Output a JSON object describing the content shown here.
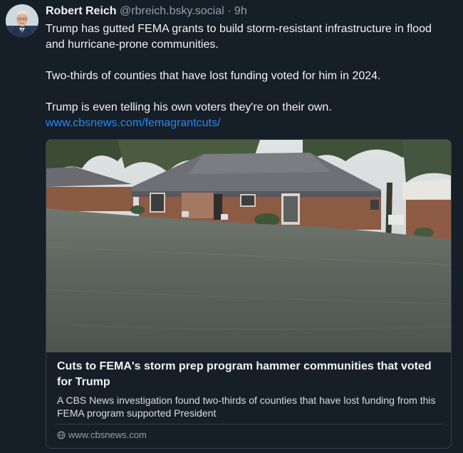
{
  "author": {
    "name": "Robert Reich",
    "handle": "@rbreich.bsky.social",
    "separator": "·",
    "time": "9h",
    "avatar_icon": "profile-photo"
  },
  "post": {
    "paragraphs": [
      "Trump has gutted FEMA grants to build storm-resistant infrastructure in flood and hurricane-prone communities.",
      "Two-thirds of counties that have lost funding voted for him in 2024.",
      "Trump is even telling his own voters they're on their own."
    ],
    "link_text": "www.cbsnews.com/femagrantcuts/"
  },
  "card": {
    "image_description_icon": "flooded-houses-photo",
    "title": "Cuts to FEMA's storm prep program hammer communities that voted for Trump",
    "description": "A CBS News investigation found two-thirds of counties that have lost funding from this FEMA program supported President",
    "domain": "www.cbsnews.com",
    "domain_icon": "globe-icon"
  },
  "colors": {
    "background": "#161e27",
    "link": "#208bfe",
    "muted": "#93a0b0",
    "border": "#2e4052"
  }
}
